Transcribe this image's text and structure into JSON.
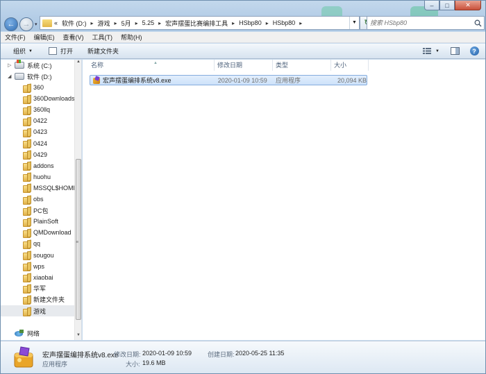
{
  "address": {
    "overflow": "«",
    "crumbs": [
      "软件 (D:)",
      "游戏",
      "5月",
      "5.25",
      "宏声摆蛋比赛编排工具",
      "HSbp80",
      "HSbp80"
    ]
  },
  "search": {
    "placeholder": "搜索 HSbp80"
  },
  "menu": [
    "文件(F)",
    "编辑(E)",
    "查看(V)",
    "工具(T)",
    "帮助(H)"
  ],
  "toolbar": {
    "organize": "组织",
    "open": "打开",
    "new_folder": "新建文件夹"
  },
  "nav": {
    "drives": [
      {
        "label": "系统 (C:)"
      },
      {
        "label": "软件 (D:)"
      }
    ],
    "folders": [
      "360",
      "360Downloads",
      "360llq",
      "0422",
      "0423",
      "0424",
      "0429",
      "addons",
      "huohu",
      "MSSQL$HOME",
      "obs",
      "PC包",
      "PlainSoft",
      "QMDownload",
      "qq",
      "sougou",
      "wps",
      "xiaobai",
      "华军",
      "新建文件夹",
      "游戏"
    ],
    "selected": "游戏",
    "network": "网络"
  },
  "columns": {
    "name": "名称",
    "modified": "修改日期",
    "type": "类型",
    "size": "大小"
  },
  "files": [
    {
      "name": "宏声摆蛋编排系统v8.exe",
      "modified": "2020-01-09 10:59",
      "type": "应用程序",
      "size": "20,094 KB"
    }
  ],
  "details": {
    "name": "宏声摆蛋编排系统v8.exe",
    "modified_label": "修改日期:",
    "modified": "2020-01-09 10:59",
    "created_label": "创建日期:",
    "created": "2020-05-25 11:35",
    "type": "应用程序",
    "size_label": "大小:",
    "size": "19.6 MB"
  },
  "icons": {
    "back": "back-arrow-icon",
    "forward": "forward-arrow-icon",
    "refresh": "refresh-icon",
    "search": "search-icon",
    "views": "view-options-icon",
    "preview": "preview-pane-icon",
    "help": "help-icon"
  },
  "colors": {
    "selection": "#cde2fa",
    "selection_border": "#84acdd",
    "header_text": "#4c607a"
  }
}
